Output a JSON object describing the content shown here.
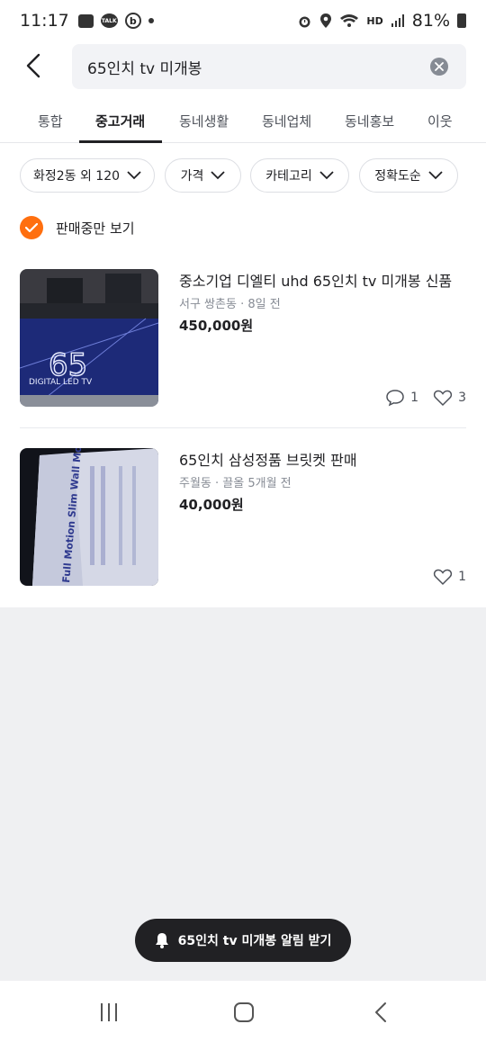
{
  "status_bar": {
    "time": "11:17",
    "talk_badge": "TALK",
    "b_badge": "b",
    "network": "HD",
    "battery_percent": "81%"
  },
  "search": {
    "query": "65인치 tv 미개봉"
  },
  "tabs": [
    {
      "label": "통합",
      "active": false
    },
    {
      "label": "중고거래",
      "active": true
    },
    {
      "label": "동네생활",
      "active": false
    },
    {
      "label": "동네업체",
      "active": false
    },
    {
      "label": "동네홍보",
      "active": false
    },
    {
      "label": "이웃",
      "active": false
    }
  ],
  "filters": [
    {
      "label": "화정2동 외 120"
    },
    {
      "label": "가격"
    },
    {
      "label": "카테고리"
    },
    {
      "label": "정확도순"
    }
  ],
  "on_sale_only": {
    "label": "판매중만 보기",
    "checked": true
  },
  "listings": [
    {
      "title": "중소기업 디엘티 uhd 65인치 tv 미개봉 신품",
      "location": "서구 쌍촌동",
      "time_ago": "8일 전",
      "price": "450,000원",
      "chats": "1",
      "likes": "3",
      "image_text_big": "65",
      "image_text_small": "DIGITAL LED TV"
    },
    {
      "title": "65인치 삼성정품 브릿켓 판매",
      "location": "주월동",
      "time_ago": "끌올 5개월 전",
      "price": "40,000원",
      "chats": "",
      "likes": "1",
      "image_text_big": "Full Motion Slim Wall Mount"
    }
  ],
  "alert_button": {
    "label": "65인치 tv 미개봉 알림 받기"
  },
  "colors": {
    "accent": "#ff6f0f",
    "dark": "#212124",
    "muted": "#868b94"
  }
}
